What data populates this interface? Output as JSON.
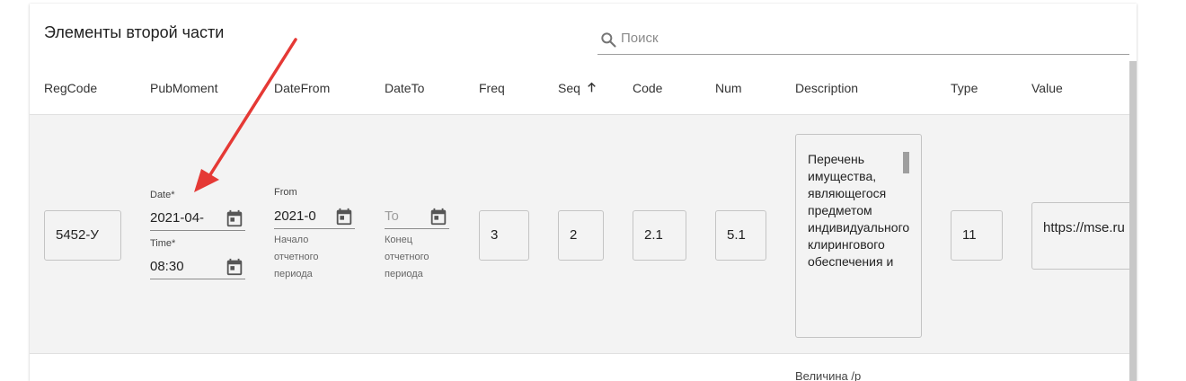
{
  "page": {
    "title": "Элементы второй части",
    "search": {
      "placeholder": "Поиск",
      "icon": "search-icon"
    }
  },
  "table": {
    "columns": [
      "RegCode",
      "PubMoment",
      "DateFrom",
      "DateTo",
      "Freq",
      "Seq",
      "Code",
      "Num",
      "Description",
      "Type",
      "Value"
    ],
    "sort": {
      "column": "Seq",
      "direction": "asc",
      "icon": "arrow-up-icon"
    },
    "rows": [
      {
        "regcode": "5452-У",
        "pubmoment": {
          "date_label": "Date*",
          "date_value": "2021-04-",
          "time_label": "Time*",
          "time_value": "08:30"
        },
        "datefrom": {
          "label": "From",
          "value": "2021-0",
          "helper": [
            "Начало",
            "отчетного",
            "периода"
          ]
        },
        "dateto": {
          "placeholder": "To",
          "helper": [
            "Конец",
            "отчетного",
            "периода"
          ]
        },
        "freq": "3",
        "seq": "2",
        "code": "2.1",
        "num": "5.1",
        "description": "Перечень имущества, являющегося предметом индивидуального клирингового обеспечения и",
        "type": "11",
        "value": "https://mse.ru"
      }
    ],
    "next_row_partial": "Величина /р"
  },
  "colors": {
    "row_background": "#f3f3f3",
    "annotation_arrow": "#e53935",
    "border": "#c4c4c4"
  }
}
